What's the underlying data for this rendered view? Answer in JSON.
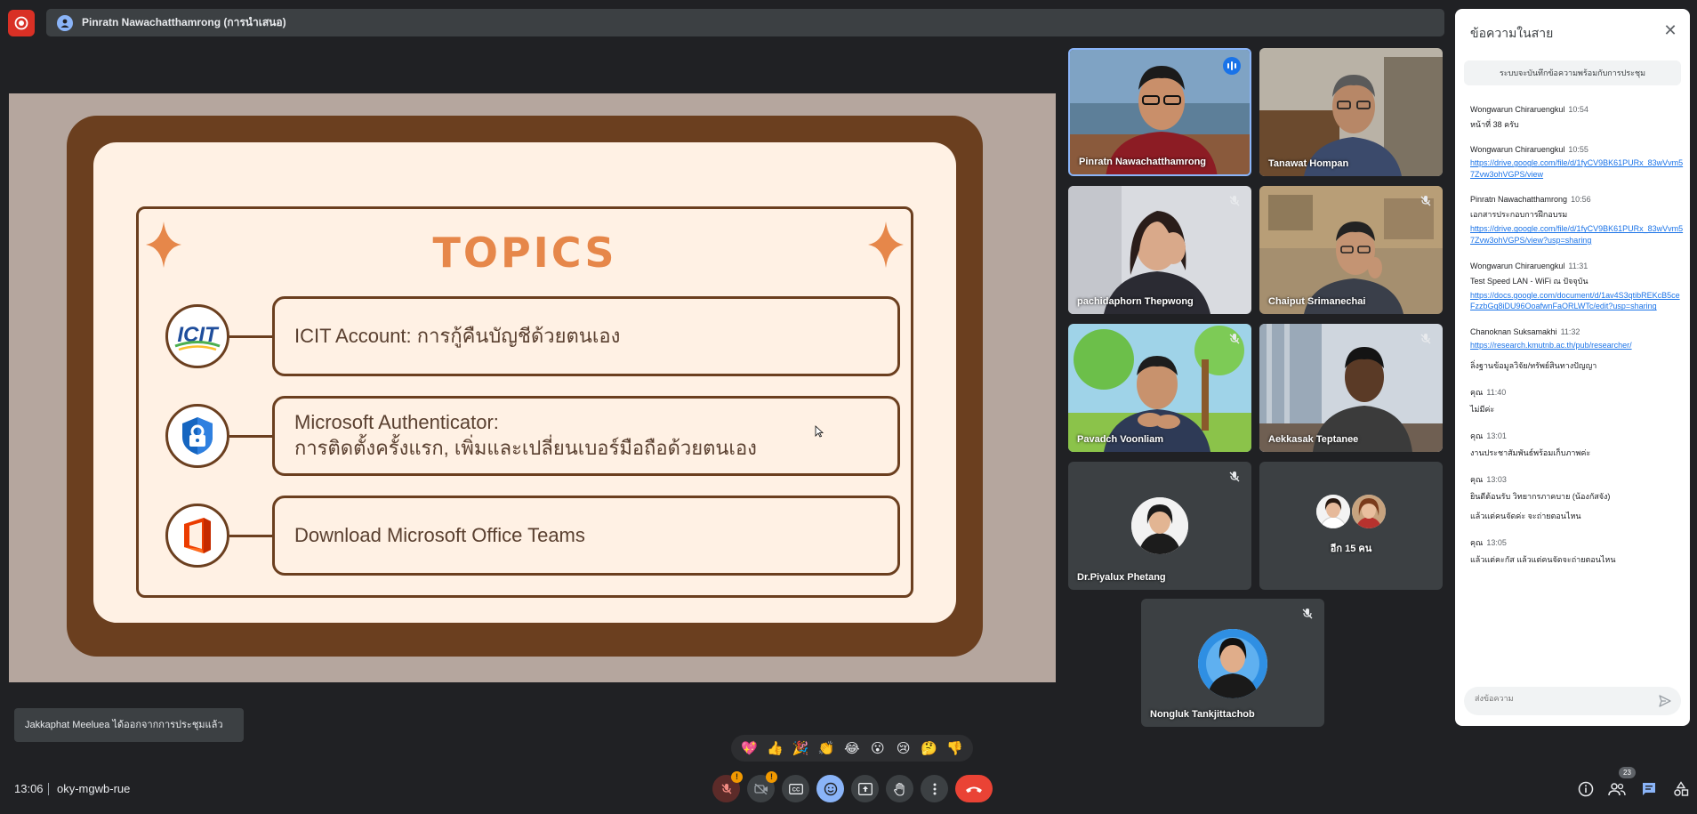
{
  "top_bar": {
    "presenter_title": "Pinratn Nawachatthamrong (การนำเสนอ)"
  },
  "slide": {
    "title": "TOPICS",
    "topics": [
      {
        "icon": "icit-logo",
        "logo_text": "ICIT",
        "lines": [
          "ICIT Account: การกู้คืนบัญชีด้วยตนเอง"
        ]
      },
      {
        "icon": "authenticator-icon",
        "lines": [
          "Microsoft Authenticator:",
          "การติดตั้งครั้งแรก, เพิ่มและเปลี่ยนเบอร์มือถือด้วยตนเอง"
        ]
      },
      {
        "icon": "office-icon",
        "lines": [
          "Download Microsoft Office Teams"
        ]
      }
    ]
  },
  "participants": [
    {
      "name": "Pinratn Nawachatthamrong",
      "muted": false,
      "speaking": true
    },
    {
      "name": "Tanawat Hompan",
      "muted": false
    },
    {
      "name": "pachidaphorn Thepwong",
      "muted": true
    },
    {
      "name": "Chaiput Srimanechai",
      "muted": true
    },
    {
      "name": "Pavadch Voonliam",
      "muted": true
    },
    {
      "name": "Aekkasak Teptanee",
      "muted": true
    },
    {
      "name": "Dr.Piyalux Phetang",
      "muted": true
    },
    {
      "name": "อีก 15 คน"
    },
    {
      "name": "Nongluk Tankjittachob",
      "muted": true
    }
  ],
  "chat": {
    "title": "ข้อความในสาย",
    "notice": "ระบบจะบันทึกข้อความพร้อมกับการประชุม",
    "messages": [
      {
        "sender": "Wongwarun Chiraruengkul",
        "time": "10:54",
        "lines": [
          "หน้าที่ 38 ครับ"
        ],
        "links": []
      },
      {
        "sender": "Wongwarun Chiraruengkul",
        "time": "10:55",
        "lines": [],
        "links": [
          "https://drive.google.com/file/d/1fyCV9BK61PURx_83wVvm57Zvw3ohVGPS/view"
        ]
      },
      {
        "sender": "Pinratn Nawachatthamrong",
        "time": "10:56",
        "lines": [
          "เอกสารประกอบการฝึกอบรม"
        ],
        "links": [
          "https://drive.google.com/file/d/1fyCV9BK61PURx_83wVvm57Zvw3ohVGPS/view?usp=sharing"
        ]
      },
      {
        "sender": "Wongwarun Chiraruengkul",
        "time": "11:31",
        "lines": [
          "Test Speed LAN - WiFi ณ ปัจจุบัน"
        ],
        "links": [
          "https://docs.google.com/document/d/1av4S3qtibREKcB5ceFzzbGq8iDU96OoafwnFaORLWTc/edit?usp=sharing"
        ]
      },
      {
        "sender": "Chanoknan Suksamakhi",
        "time": "11:32",
        "lines": [],
        "links": [
          "https://research.kmutnb.ac.th/pub/researcher/"
        ],
        "after": [
          "ลิ่งฐานข้อมูลวิจัย/ทรัพย์สินทางปัญญา"
        ]
      },
      {
        "sender": "คุณ",
        "time": "11:40",
        "lines": [
          "ไม่มีค่ะ"
        ],
        "links": []
      },
      {
        "sender": "คุณ",
        "time": "13:01",
        "lines": [
          "งานประชาสัมพันธ์พร้อมเก็บภาพค่ะ"
        ],
        "links": []
      },
      {
        "sender": "คุณ",
        "time": "13:03",
        "lines": [
          "ยินดีต้อนรับ วิทยากรภาคบาย (น้องกัสจัง)",
          "แล้วแต่คนจัดค่ะ จะถ่ายตอนไหน"
        ],
        "links": []
      },
      {
        "sender": "คุณ",
        "time": "13:05",
        "lines": [
          "แล้วแต่คะกัส แล้วแต่คนจัดจะถ่ายตอนไหน"
        ],
        "links": []
      }
    ],
    "input_placeholder": "ส่งข้อความ"
  },
  "toast": "Jakkaphat Meeluea ได้ออกจากการประชุมแล้ว",
  "reactions": [
    "💖",
    "👍",
    "🎉",
    "👏",
    "😂",
    "😮",
    "😢",
    "🤔",
    "👎"
  ],
  "bottom": {
    "time": "13:06",
    "meeting_code": "oky-mgwb-rue",
    "warning_badge": "!",
    "people_count": "23"
  },
  "colors": {
    "accent": "#8ab4f8",
    "danger": "#ea4335",
    "slide_brown": "#6b3f1f",
    "slide_orange": "#e6874a"
  }
}
